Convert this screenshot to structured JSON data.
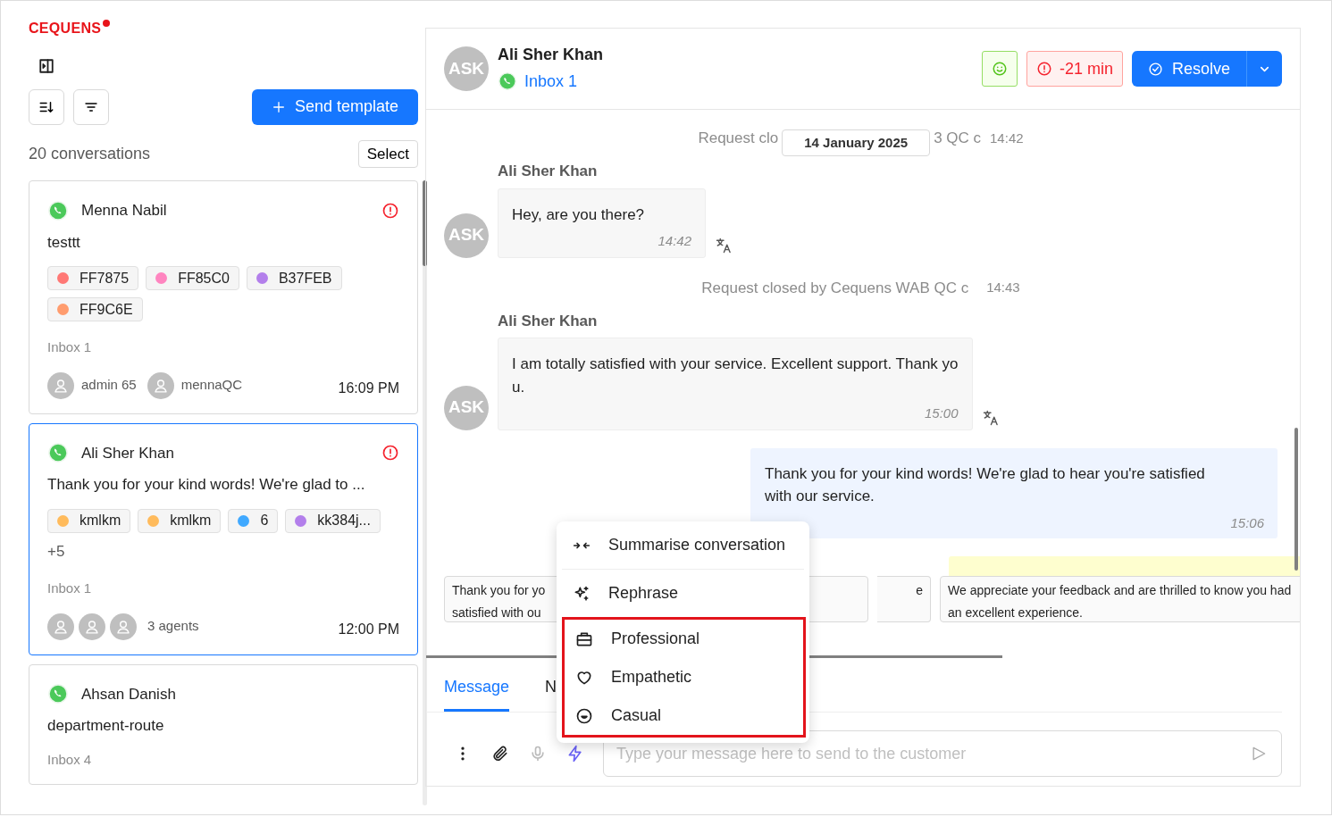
{
  "logo": "CEQUENS",
  "sidebar": {
    "send_template": "Send template",
    "count": "20 conversations",
    "select": "Select",
    "conversations": [
      {
        "name": "Menna Nabil",
        "overdue": true,
        "selected": false,
        "preview": "testtt",
        "tags": [
          {
            "label": "FF7875",
            "color": "#ff7875"
          },
          {
            "label": "FF85C0",
            "color": "#ff85c0"
          },
          {
            "label": "B37FEB",
            "color": "#b37feb"
          },
          {
            "label": "FF9C6E",
            "color": "#ff9c6e"
          }
        ],
        "inbox": "Inbox 1",
        "agents": [
          {
            "kind": "named",
            "name": "admin 65"
          },
          {
            "kind": "named",
            "name": "mennaQC"
          }
        ],
        "time": "16:09 PM"
      },
      {
        "name": "Ali Sher Khan",
        "overdue": true,
        "selected": true,
        "preview": "Thank you for your kind words! We're glad to ...",
        "tags": [
          {
            "label": "kmlkm",
            "color": "#ffbb5c"
          },
          {
            "label": "kmlkm",
            "color": "#ffbb5c"
          },
          {
            "label": "6",
            "color": "#40a9ff"
          },
          {
            "label": "kk384j...",
            "color": "#b37feb"
          }
        ],
        "more": "+5",
        "inbox": "Inbox 1",
        "agents": [
          {
            "kind": "avatar"
          },
          {
            "kind": "avatar"
          },
          {
            "kind": "avatar"
          }
        ],
        "agents_label": "3 agents",
        "time": "12:00 PM"
      },
      {
        "name": "Ahsan Danish",
        "overdue": false,
        "selected": false,
        "preview": "department-route",
        "inbox": "Inbox 4"
      }
    ]
  },
  "chat": {
    "initials": "ASK",
    "name": "Ali Sher Khan",
    "inbox": "Inbox 1",
    "sla": "-21 min",
    "resolve": "Resolve",
    "messages": [
      {
        "kind": "system",
        "before": "Request clo",
        "date": "14 January 2025",
        "after": "3 QC c",
        "time": "14:42"
      },
      {
        "kind": "incoming",
        "sender": "Ali Sher Khan",
        "initials": "ASK",
        "lines": [
          "Hey, are you there?"
        ],
        "time": "14:42"
      },
      {
        "kind": "system",
        "before": "Request closed by Cequens WAB QC c",
        "time": "14:43"
      },
      {
        "kind": "incoming",
        "sender": "Ali Sher Khan",
        "initials": "ASK",
        "lines": [
          "I am totally satisfied with your service. Excellent support. Thank yo",
          "u."
        ],
        "time": "15:00"
      },
      {
        "kind": "outgoing",
        "lines": [
          "Thank you for your kind words! We're glad to hear you're satisfied",
          "with our service."
        ],
        "time": "15:06"
      }
    ],
    "suggestions": [
      {
        "lines": [
          "Thank you for yo",
          "satisfied with ou"
        ]
      },
      {
        "lines": [
          "e"
        ]
      },
      {
        "lines": [
          "We appreciate your feedback and are thrilled to know you had",
          "an excellent experience."
        ]
      }
    ],
    "tabs": [
      {
        "label": "Message",
        "selected": true
      },
      {
        "label": "N",
        "selected": false
      }
    ],
    "placeholder": "Type your message here to send to the customer",
    "ai_menu": [
      {
        "label": "Summarise conversation",
        "highlighted": false
      },
      {
        "label": "Rephrase",
        "highlighted": false
      },
      {
        "label": "Professional",
        "highlighted": true
      },
      {
        "label": "Empathetic",
        "highlighted": true
      },
      {
        "label": "Casual",
        "highlighted": true
      }
    ]
  }
}
